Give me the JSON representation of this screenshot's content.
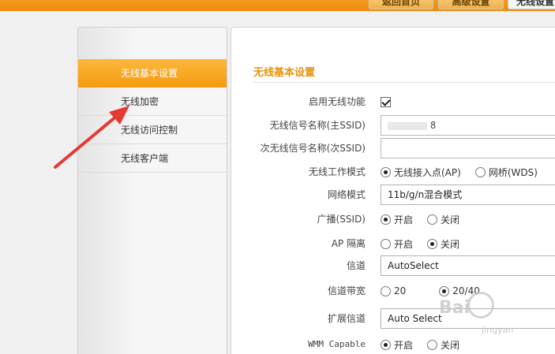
{
  "top_tabs": [
    {
      "label": "返回首页"
    },
    {
      "label": "高级设置"
    },
    {
      "label": "无线设置"
    }
  ],
  "sidebar": {
    "items": [
      {
        "label": "无线基本设置",
        "active": true
      },
      {
        "label": "无线加密",
        "active": false
      },
      {
        "label": "无线访问控制",
        "active": false
      },
      {
        "label": "无线客户端",
        "active": false
      }
    ]
  },
  "panel": {
    "title": "无线基本设置",
    "fields": {
      "enable": {
        "label": "启用无线功能",
        "checked": true
      },
      "ssid": {
        "label": "无线信号名称(主SSID)",
        "value": "8"
      },
      "ssid2": {
        "label": "次无线信号名称(次SSID)",
        "value": ""
      },
      "mode": {
        "label": "无线工作模式",
        "options": [
          "无线接入点(AP)",
          "网桥(WDS)"
        ],
        "selected": "无线接入点(AP)"
      },
      "netmode": {
        "label": "网络模式",
        "value": "11b/g/n混合模式"
      },
      "broadcast": {
        "label": "广播(SSID)",
        "options": [
          "开启",
          "关闭"
        ],
        "selected": "开启"
      },
      "ap_isolation": {
        "label": "AP 隔离",
        "options": [
          "开启",
          "关闭"
        ],
        "selected": "关闭"
      },
      "channel": {
        "label": "信道",
        "value": "AutoSelect"
      },
      "bandwidth": {
        "label": "信道带宽",
        "options": [
          "20",
          "20/40"
        ],
        "selected": "20/40"
      },
      "ext_channel": {
        "label": "扩展信道",
        "value": "Auto Select"
      },
      "wmm": {
        "label": "WMM Capable",
        "options": [
          "开启",
          "关闭"
        ],
        "selected": "开启"
      }
    }
  },
  "watermark": {
    "text": "Bai",
    "sub": "jingyan"
  },
  "colors": {
    "accent": "#f59a0f",
    "title": "#e8920c",
    "arrow": "#e53935"
  }
}
